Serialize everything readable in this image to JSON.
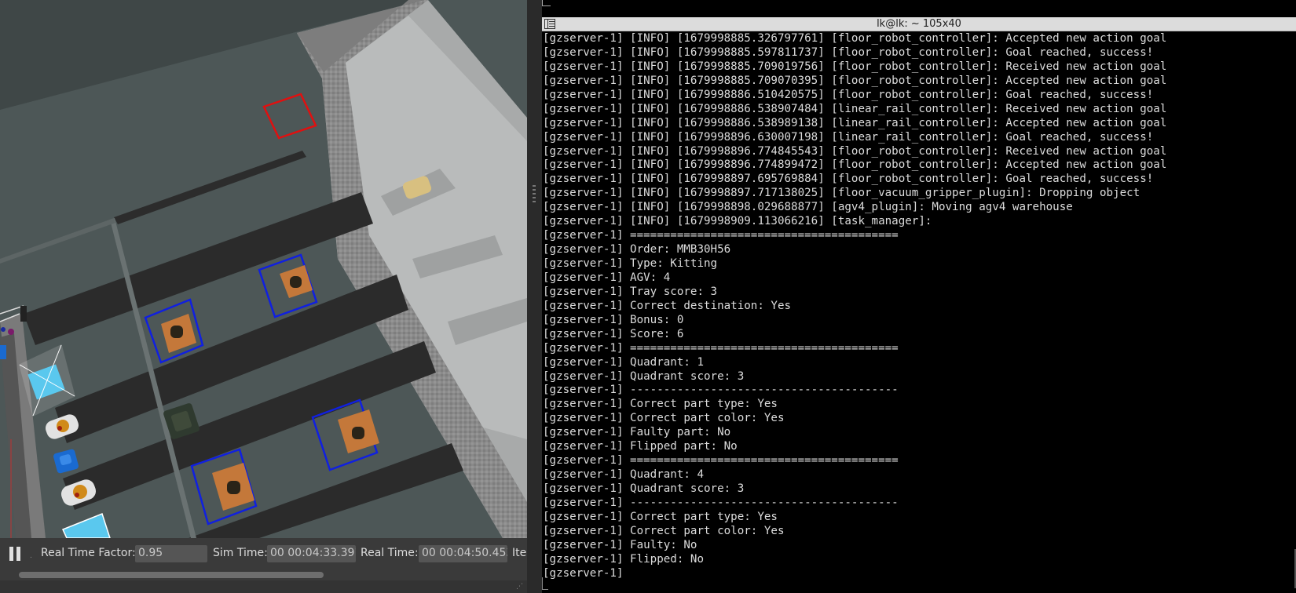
{
  "gazebo": {
    "statusbar": {
      "real_time_factor_label": "Real Time Factor:",
      "real_time_factor_value": "0.95",
      "sim_time_label": "Sim Time:",
      "sim_time_value": "00 00:04:33.391",
      "real_time_label": "Real Time:",
      "real_time_value": "00 00:04:50.453",
      "iterations_label": "Ite"
    }
  },
  "terminal": {
    "title": "lk@lk: ~ 105x40",
    "lines": [
      "[gzserver-1] [INFO] [1679998885.326797761] [floor_robot_controller]: Accepted new action goal",
      "[gzserver-1] [INFO] [1679998885.597811737] [floor_robot_controller]: Goal reached, success!",
      "[gzserver-1] [INFO] [1679998885.709019756] [floor_robot_controller]: Received new action goal",
      "[gzserver-1] [INFO] [1679998885.709070395] [floor_robot_controller]: Accepted new action goal",
      "[gzserver-1] [INFO] [1679998886.510420575] [floor_robot_controller]: Goal reached, success!",
      "[gzserver-1] [INFO] [1679998886.538907484] [linear_rail_controller]: Received new action goal",
      "[gzserver-1] [INFO] [1679998886.538989138] [linear_rail_controller]: Accepted new action goal",
      "[gzserver-1] [INFO] [1679998896.630007198] [linear_rail_controller]: Goal reached, success!",
      "[gzserver-1] [INFO] [1679998896.774845543] [floor_robot_controller]: Received new action goal",
      "[gzserver-1] [INFO] [1679998896.774899472] [floor_robot_controller]: Accepted new action goal",
      "[gzserver-1] [INFO] [1679998897.695769884] [floor_robot_controller]: Goal reached, success!",
      "[gzserver-1] [INFO] [1679998897.717138025] [floor_vacuum_gripper_plugin]: Dropping object",
      "[gzserver-1] [INFO] [1679998898.029688877] [agv4_plugin]: Moving agv4 warehouse",
      "[gzserver-1] [INFO] [1679998909.113066216] [task_manager]:",
      "[gzserver-1] ========================================",
      "[gzserver-1] Order: MMB30H56",
      "[gzserver-1] Type: Kitting",
      "[gzserver-1] AGV: 4",
      "[gzserver-1] Tray score: 3",
      "[gzserver-1] Correct destination: Yes",
      "[gzserver-1] Bonus: 0",
      "[gzserver-1] Score: 6",
      "[gzserver-1] ========================================",
      "[gzserver-1] Quadrant: 1",
      "[gzserver-1] Quadrant score: 3",
      "[gzserver-1] ----------------------------------------",
      "[gzserver-1] Correct part type: Yes",
      "[gzserver-1] Correct part color: Yes",
      "[gzserver-1] Faulty part: No",
      "[gzserver-1] Flipped part: No",
      "[gzserver-1] ========================================",
      "[gzserver-1] Quadrant: 4",
      "[gzserver-1] Quadrant score: 3",
      "[gzserver-1] ----------------------------------------",
      "[gzserver-1] Correct part type: Yes",
      "[gzserver-1] Correct part color: Yes",
      "[gzserver-1] Faulty: No",
      "[gzserver-1] Flipped: No",
      "[gzserver-1]"
    ]
  },
  "colors": {
    "terminal_bg": "#000000",
    "terminal_fg": "#dcdcdc",
    "floor": "#4d5757",
    "wall": "#8e8e8e",
    "marker_red": "#e01010",
    "marker_blue": "#1020e0",
    "tray": "#c4783a"
  },
  "icons": {
    "pause": "pause-icon",
    "terminal_menu": "terminal-menu-icon"
  }
}
